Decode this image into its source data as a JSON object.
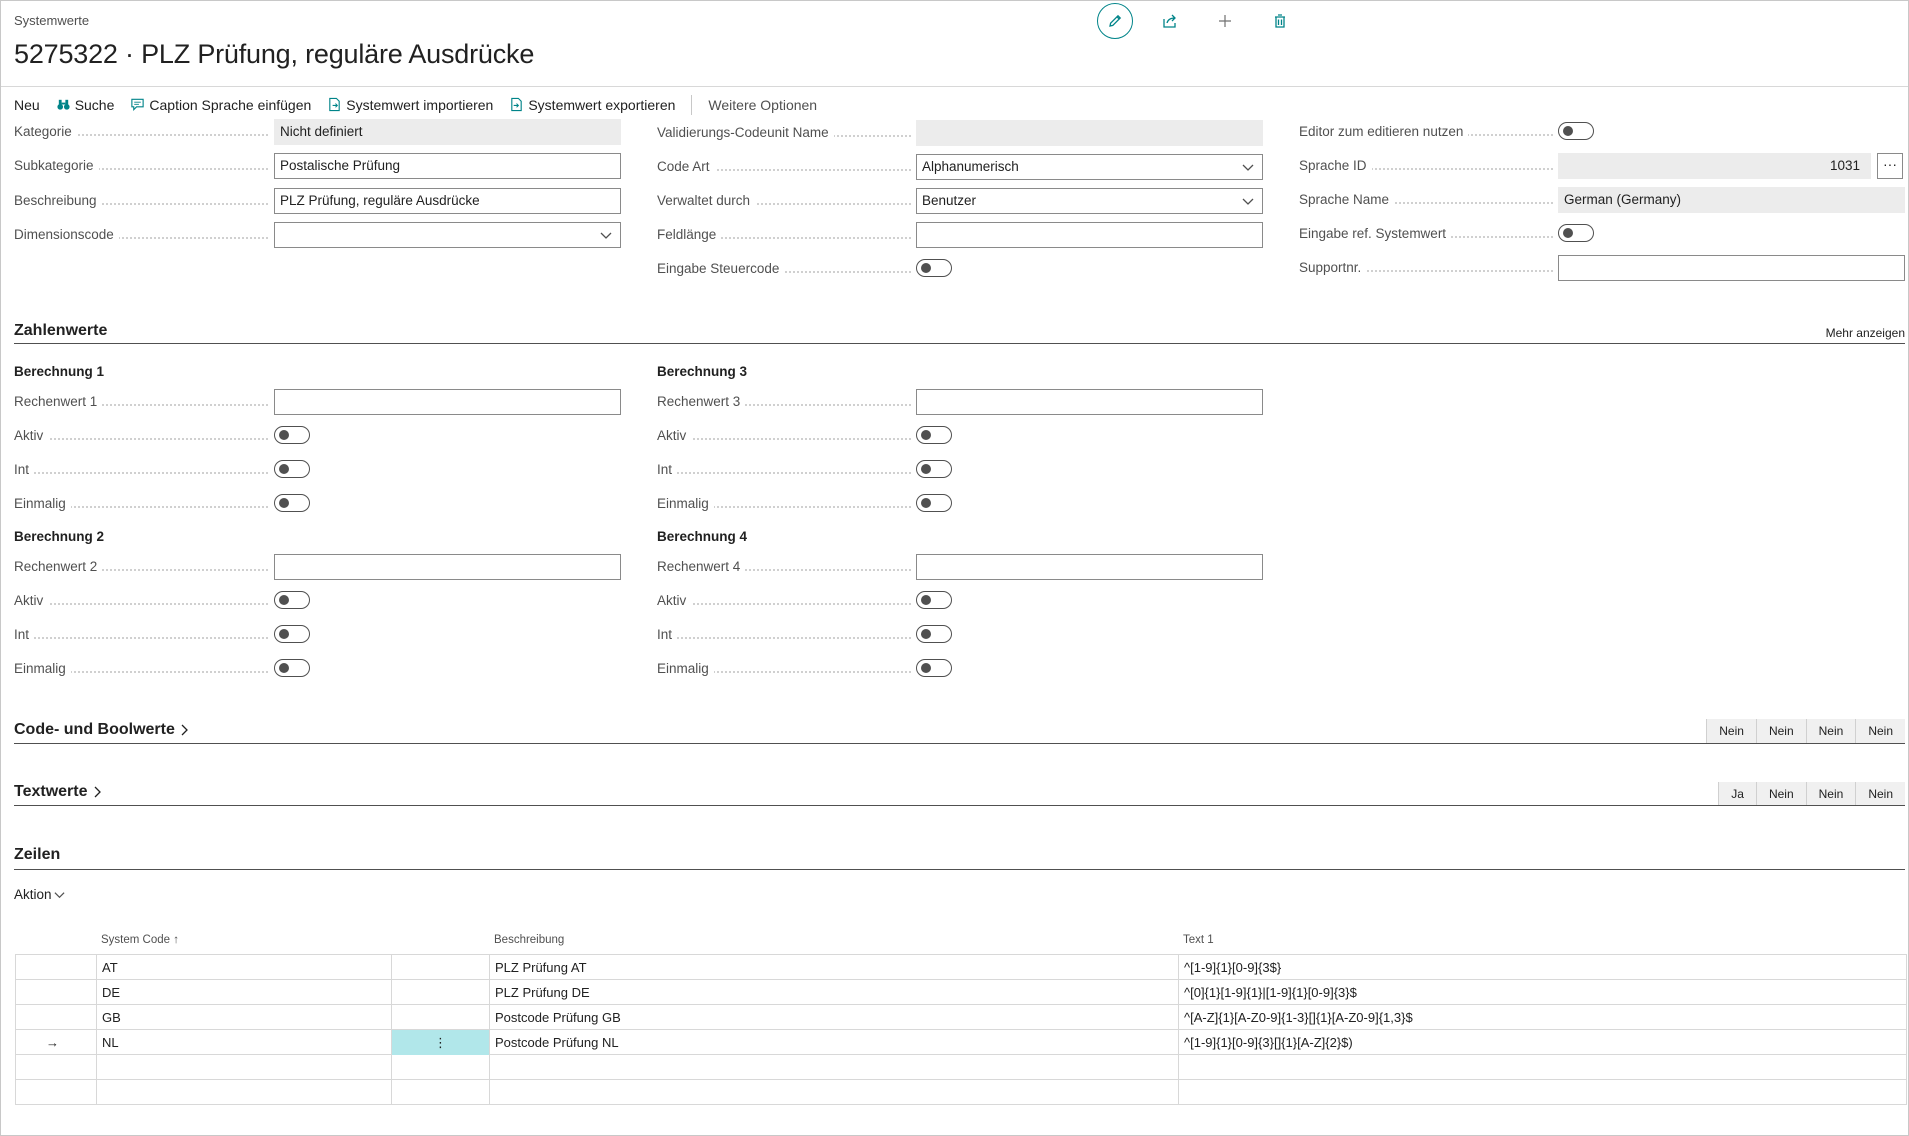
{
  "header": {
    "breadcrumb": "Systemwerte",
    "title": "5275322 · PLZ Prüfung, reguläre Ausdrücke",
    "icons": [
      "pencil-icon",
      "share-icon",
      "plus-icon",
      "trash-icon"
    ]
  },
  "actions": {
    "neu": "Neu",
    "suche": "Suche",
    "caption": "Caption Sprache einfügen",
    "import": "Systemwert importieren",
    "export": "Systemwert exportieren",
    "more": "Weitere Optionen"
  },
  "general": {
    "kategorie_label": "Kategorie",
    "kategorie_value": "Nicht definiert",
    "subkategorie_label": "Subkategorie",
    "subkategorie_value": "Postalische Prüfung",
    "beschreibung_label": "Beschreibung",
    "beschreibung_value": "PLZ Prüfung, reguläre Ausdrücke",
    "dimensionscode_label": "Dimensionscode",
    "dimensionscode_value": "",
    "validierung_label": "Validierungs-Codeunit Name",
    "validierung_value": "",
    "codeart_label": "Code Art",
    "codeart_value": "Alphanumerisch",
    "verwaltet_label": "Verwaltet durch",
    "verwaltet_value": "Benutzer",
    "feldlaenge_label": "Feldlänge",
    "feldlaenge_value": "",
    "steuercode_label": "Eingabe Steuercode",
    "steuercode_on": false,
    "editor_label": "Editor zum editieren nutzen",
    "editor_on": false,
    "sprache_id_label": "Sprache ID",
    "sprache_id_value": "1031",
    "sprache_name_label": "Sprache Name",
    "sprache_name_value": "German (Germany)",
    "refsys_label": "Eingabe ref. Systemwert",
    "refsys_on": false,
    "support_label": "Supportnr.",
    "support_value": ""
  },
  "zahlenwerte": {
    "title": "Zahlenwerte",
    "mehr": "Mehr anzeigen",
    "b1": "Berechnung 1",
    "b2": "Berechnung 2",
    "b3": "Berechnung 3",
    "b4": "Berechnung 4",
    "rw1": "Rechenwert 1",
    "rw2": "Rechenwert 2",
    "rw3": "Rechenwert 3",
    "rw4": "Rechenwert 4",
    "aktiv": "Aktiv",
    "int": "Int",
    "einmalig": "Einmalig"
  },
  "code_bool": {
    "title": "Code- und Boolwerte",
    "pills": [
      "Nein",
      "Nein",
      "Nein",
      "Nein"
    ]
  },
  "textwerte": {
    "title": "Textwerte",
    "pills": [
      "Ja",
      "Nein",
      "Nein",
      "Nein"
    ]
  },
  "zeilen": {
    "title": "Zeilen",
    "aktion": "Aktion",
    "columns": {
      "system_code": "System Code ↑",
      "beschreibung": "Beschreibung",
      "text1": "Text 1"
    },
    "rows": [
      {
        "code": "AT",
        "desc": " PLZ Prüfung AT",
        "text": "^[1-9]{1}[0-9]{3$}"
      },
      {
        "code": "DE",
        "desc": "PLZ Prüfung DE",
        "text": "^[0]{1}[1-9]{1}|[1-9]{1}[0-9]{3}$"
      },
      {
        "code": "GB",
        "desc": "Postcode Prüfung GB",
        "text": "^[A-Z]{1}[A-Z0-9]{1-3}[]{1}[A-Z0-9]{1,3}$"
      },
      {
        "code": "NL",
        "desc": "Postcode Prüfung NL",
        "text": "^[1-9]{1}[0-9]{3}[]{1}[A-Z]{2}$)"
      }
    ],
    "selected_marker": "→",
    "row_menu": "⋮"
  },
  "colors": {
    "accent": "#008489",
    "selected_cell": "#b1e7ea"
  }
}
